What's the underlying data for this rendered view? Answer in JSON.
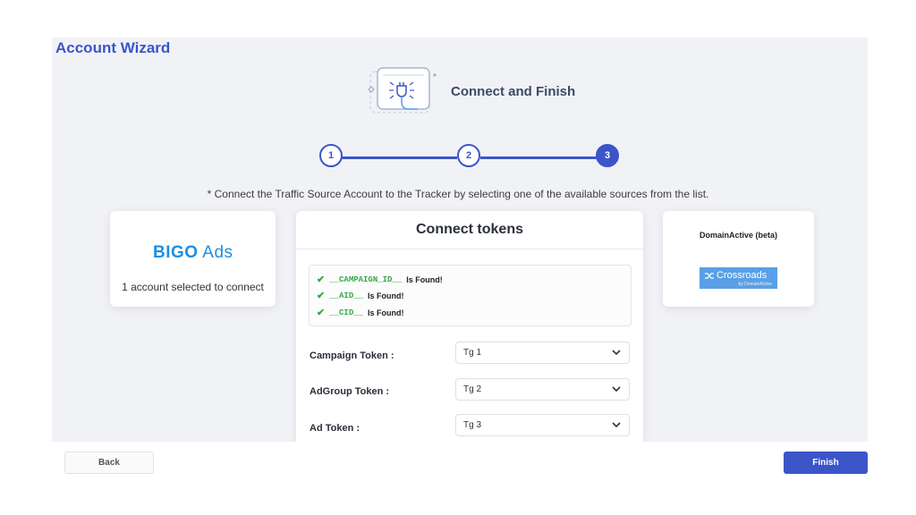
{
  "header": {
    "title": "Account Wizard"
  },
  "hero": {
    "icon": "plug-connect-icon",
    "text": "Connect and Finish"
  },
  "stepper": {
    "steps": [
      "1",
      "2",
      "3"
    ],
    "active_step": "3"
  },
  "hint": "* Connect the Traffic Source Account to the Tracker by selecting one of the available sources from the list.",
  "source_card": {
    "logo_bold": "BIGO",
    "logo_light": " Ads",
    "subtitle": "1 account selected to connect"
  },
  "connect": {
    "title": "Connect tokens",
    "found": [
      {
        "code": "__CAMPAIGN_ID__",
        "text": "Is Found!"
      },
      {
        "code": "__AID__",
        "text": "Is Found!"
      },
      {
        "code": "__CID__",
        "text": "Is Found!"
      }
    ],
    "fields": [
      {
        "label": "Campaign Token :",
        "value": "Tg 1"
      },
      {
        "label": "AdGroup Token :",
        "value": "Tg 2"
      },
      {
        "label": "Ad Token :",
        "value": "Tg 3"
      }
    ]
  },
  "tracker_card": {
    "title": "DomainActive (beta)",
    "logo_text": "Crossroads",
    "logo_sub": "by DomainActive"
  },
  "footer": {
    "back_label": "Back",
    "finish_label": "Finish"
  },
  "colors": {
    "accent": "#3b55c9",
    "success": "#3aa64a",
    "bigo": "#1a8fe3",
    "crossroads": "#5aa0e6"
  }
}
